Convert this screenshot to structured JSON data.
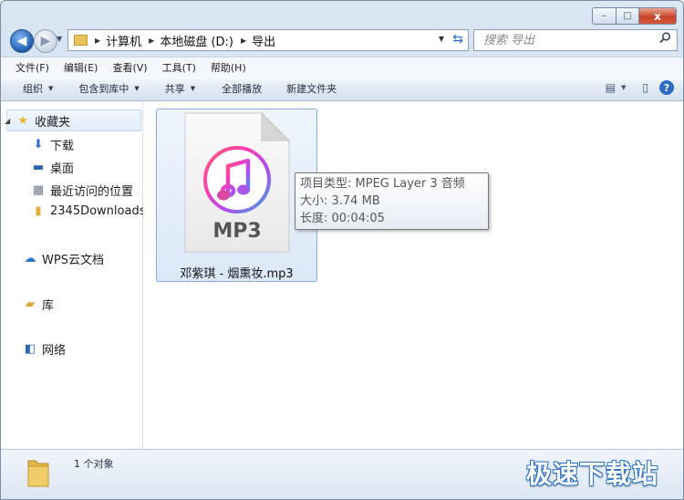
{
  "window": {
    "controls": {
      "minimize": "–",
      "maximize": "□",
      "close": "x"
    }
  },
  "address": {
    "crumbs": [
      "计算机",
      "本地磁盘 (D:)",
      "导出"
    ]
  },
  "search": {
    "placeholder": "搜索 导出"
  },
  "menubar": {
    "items": [
      "文件(F)",
      "编辑(E)",
      "查看(V)",
      "工具(T)",
      "帮助(H)"
    ]
  },
  "toolbar": {
    "organize": "组织",
    "include_library": "包含到库中",
    "share": "共享",
    "play_all": "全部播放",
    "new_folder": "新建文件夹"
  },
  "nav": {
    "favorites": "收藏夹",
    "downloads": "下载",
    "desktop": "桌面",
    "recent": "最近访问的位置",
    "folder_2345": "2345Downloads",
    "wps_cloud": "WPS云文档",
    "libraries": "库",
    "network": "网络"
  },
  "file": {
    "name": "邓紫琪 - 烟熏妆.mp3",
    "icon_label": "MP3",
    "tooltip": {
      "type": "项目类型: MPEG Layer 3 音频",
      "size": "大小: 3.74 MB",
      "duration": "长度: 00:04:05"
    }
  },
  "status": {
    "count": "1 个对象"
  },
  "watermark": "极速下载站",
  "colors": {
    "accent": "#2c6bc4",
    "selection": "#dbe8f7",
    "titlebar": "#cddbec"
  }
}
